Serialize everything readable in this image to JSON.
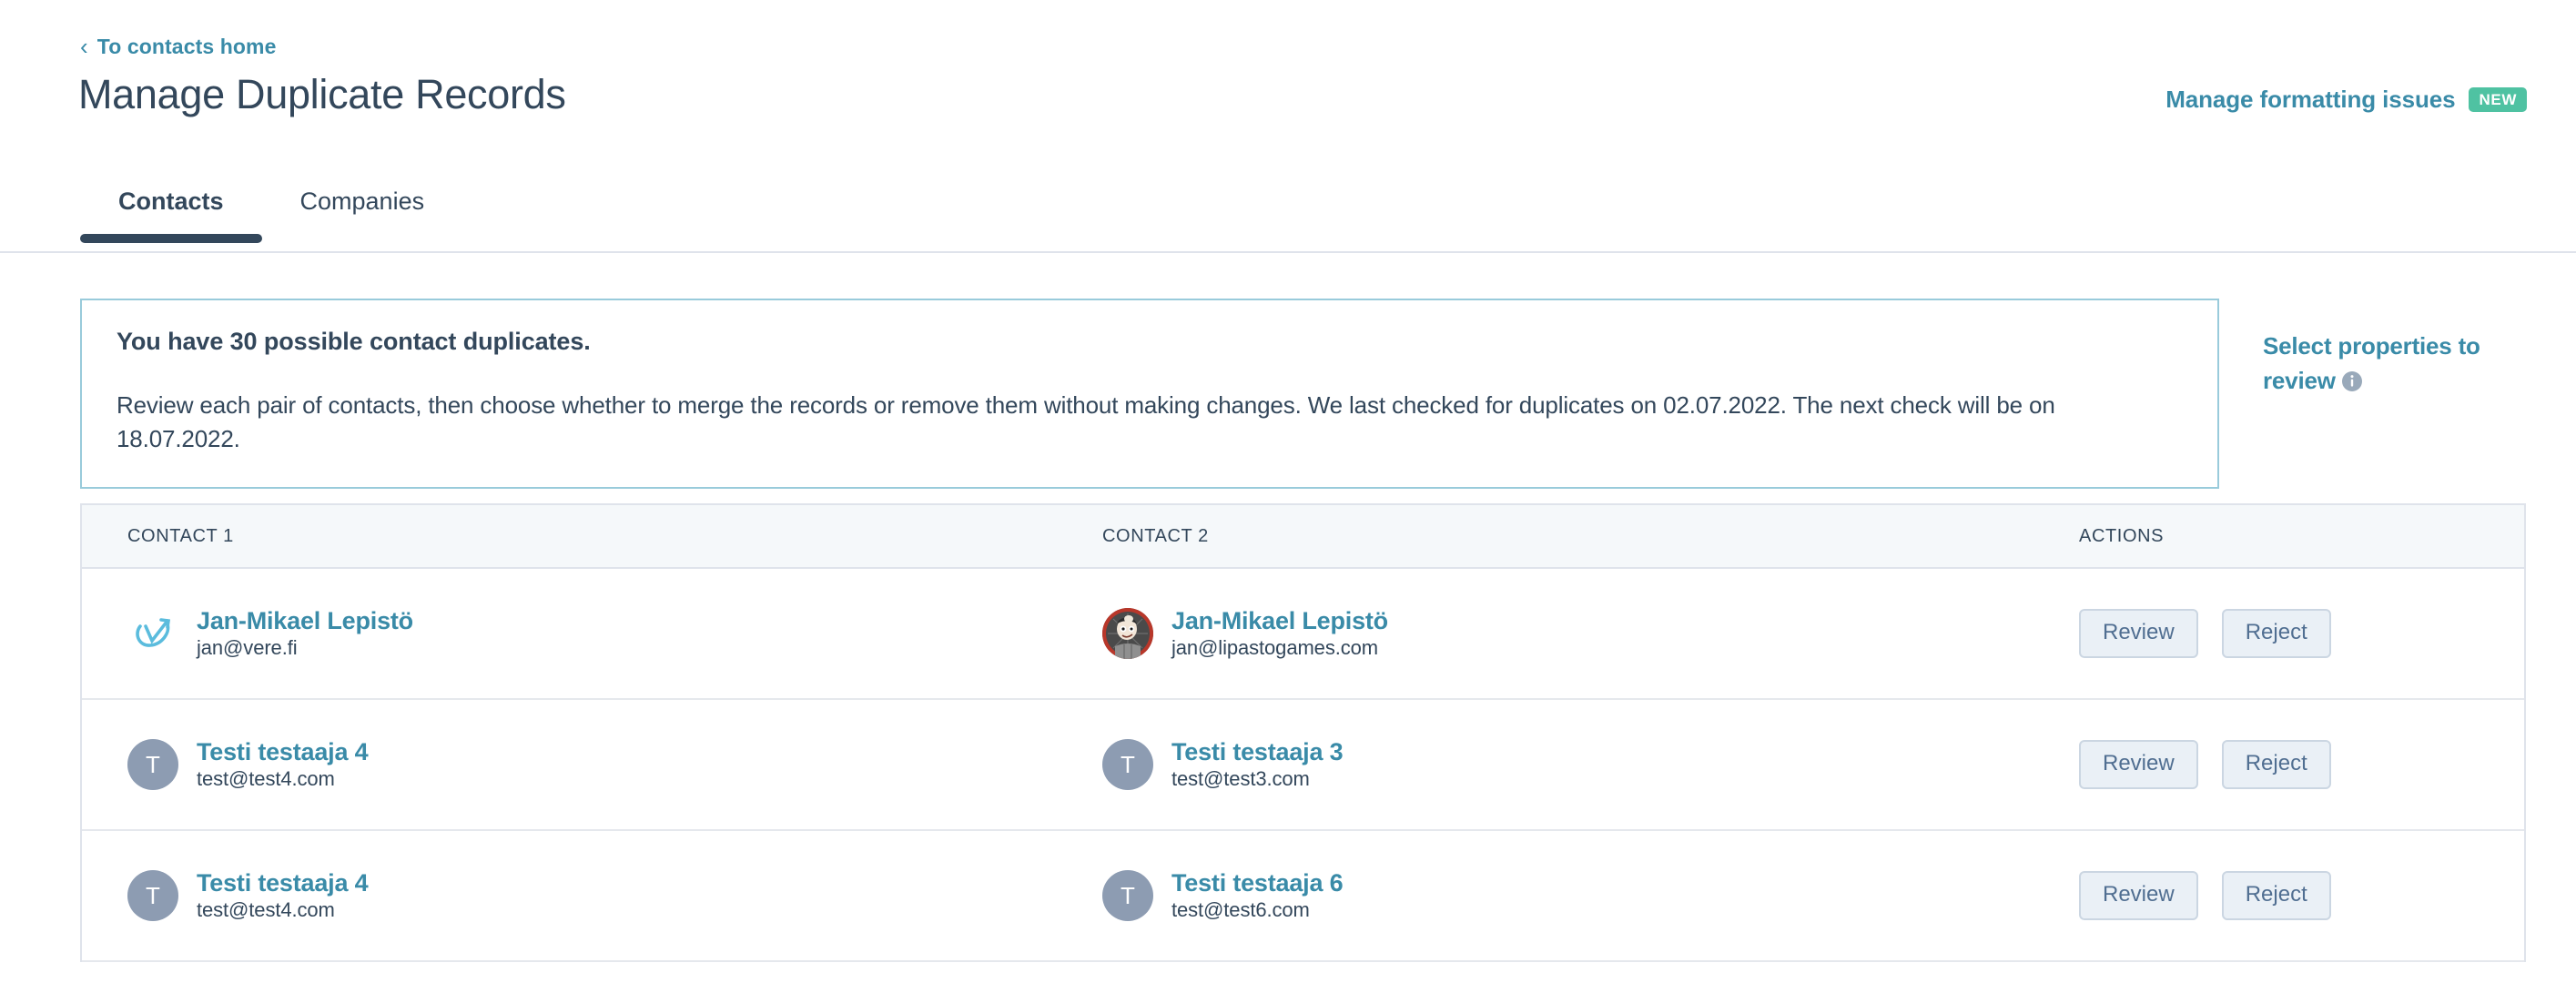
{
  "breadcrumb": {
    "label": "To contacts home",
    "chevron": "‹"
  },
  "header": {
    "title": "Manage Duplicate Records",
    "formatting_link": "Manage formatting issues",
    "new_badge": "NEW"
  },
  "colors": {
    "link": "#3a8ba8",
    "title": "#33475b",
    "badge_new": "#4fc2a2",
    "callout_border": "#99cbdb",
    "table_border": "#dfe3eb",
    "header_bg": "#f5f8fa",
    "avatar_initials_bg": "#8d9cb2",
    "button_bg": "#eaf0f6",
    "button_border": "#cbd6e2",
    "button_text": "#506e91"
  },
  "tabs": [
    {
      "label": "Contacts",
      "active": true
    },
    {
      "label": "Companies",
      "active": false
    }
  ],
  "callout": {
    "title": "You have 30 possible contact duplicates.",
    "body": "Review each pair of contacts, then choose whether to merge the records or remove them without making changes. We last checked for duplicates on 02.07.2022. The next check will be on 18.07.2022.",
    "duplicate_count": 30,
    "last_checked": "02.07.2022",
    "next_check": "18.07.2022"
  },
  "select_properties": {
    "label": "Select properties to review",
    "info_icon": "info-icon"
  },
  "table": {
    "columns": [
      {
        "key": "contact1",
        "label": "CONTACT 1"
      },
      {
        "key": "contact2",
        "label": "CONTACT 2"
      },
      {
        "key": "actions",
        "label": "ACTIONS"
      }
    ],
    "rows": [
      {
        "contact1": {
          "name": "Jan-Mikael Lepistö",
          "email": "jan@vere.fi",
          "avatar_type": "logo",
          "avatar_name": "vere-logo-avatar",
          "initial": ""
        },
        "contact2": {
          "name": "Jan-Mikael Lepistö",
          "email": "jan@lipastogames.com",
          "avatar_type": "photo",
          "avatar_name": "cartoon-photo-avatar",
          "initial": ""
        },
        "actions": {
          "review": "Review",
          "reject": "Reject"
        }
      },
      {
        "contact1": {
          "name": "Testi testaaja 4",
          "email": "test@test4.com",
          "avatar_type": "initials",
          "avatar_name": "initials-avatar",
          "initial": "T"
        },
        "contact2": {
          "name": "Testi testaaja 3",
          "email": "test@test3.com",
          "avatar_type": "initials",
          "avatar_name": "initials-avatar",
          "initial": "T"
        },
        "actions": {
          "review": "Review",
          "reject": "Reject"
        }
      },
      {
        "contact1": {
          "name": "Testi testaaja 4",
          "email": "test@test4.com",
          "avatar_type": "initials",
          "avatar_name": "initials-avatar",
          "initial": "T"
        },
        "contact2": {
          "name": "Testi testaaja 6",
          "email": "test@test6.com",
          "avatar_type": "initials",
          "avatar_name": "initials-avatar",
          "initial": "T"
        },
        "actions": {
          "review": "Review",
          "reject": "Reject"
        }
      }
    ]
  }
}
